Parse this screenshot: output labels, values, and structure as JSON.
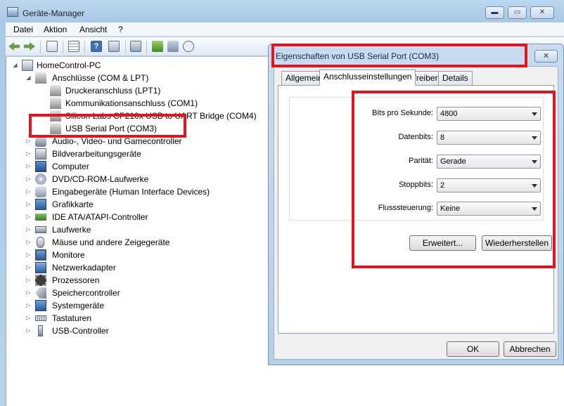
{
  "main_window": {
    "title": "Geräte-Manager",
    "caption_buttons": {
      "minimize": "▬",
      "maximize": "▭",
      "close": "✕"
    }
  },
  "menu": [
    "Datei",
    "Aktion",
    "Ansicht",
    "?"
  ],
  "toolbar_icons": [
    "back-icon",
    "forward-icon",
    "properties-view-icon",
    "list-icon",
    "help-icon",
    "devices-icon",
    "update-driver-icon",
    "uninstall-icon",
    "scan-hardware-icon"
  ],
  "tree": {
    "root": "HomeControl-PC",
    "ports_category": "Anschlüsse (COM & LPT)",
    "ports": [
      "Druckeranschluss (LPT1)",
      "Kommunikationsanschluss (COM1)",
      "Silicon Labs CP210x USB to UART Bridge (COM4)",
      "USB Serial Port (COM3)"
    ],
    "categories": [
      "Audio-, Video- und Gamecontroller",
      "Bildverarbeitungsgeräte",
      "Computer",
      "DVD/CD-ROM-Laufwerke",
      "Eingabegeräte (Human Interface Devices)",
      "Grafikkarte",
      "IDE ATA/ATAPI-Controller",
      "Laufwerke",
      "Mäuse und andere Zeigegeräte",
      "Monitore",
      "Netzwerkadapter",
      "Prozessoren",
      "Speichercontroller",
      "Systemgeräte",
      "Tastaturen",
      "USB-Controller"
    ],
    "expander_expanded": "◢",
    "expander_collapsed": "▷"
  },
  "dialog": {
    "title": "Eigenschaften von USB Serial Port (COM3)",
    "close_glyph": "✕",
    "tabs": [
      "Allgemein",
      "Anschlusseinstellungen",
      "Treiber",
      "Details"
    ],
    "active_tab": "Anschlusseinstellungen",
    "fields": [
      {
        "label": "Bits pro Sekunde:",
        "value": "4800"
      },
      {
        "label": "Datenbits:",
        "value": "8"
      },
      {
        "label": "Parität:",
        "value": "Gerade"
      },
      {
        "label": "Stoppbits:",
        "value": "2"
      },
      {
        "label": "Flusssteuerung:",
        "value": "Keine"
      }
    ],
    "advanced_button": "Erweitert...",
    "restore_button": "Wiederherstellen",
    "ok_button": "OK",
    "cancel_button": "Abbrechen"
  },
  "colors": {
    "highlight_box": "#e1151d",
    "window_frame": "#b5cfe9"
  }
}
